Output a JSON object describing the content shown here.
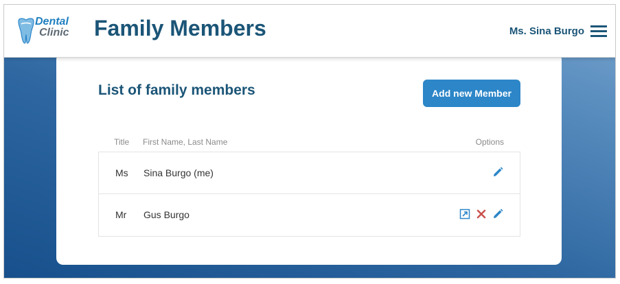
{
  "header": {
    "logo": {
      "line1": "Dental",
      "line2": "Clinic"
    },
    "title": "Family Members",
    "user_name": "Ms. Sina Burgo",
    "menu_icon": "hamburger-menu-icon"
  },
  "main": {
    "section_title": "List of family members",
    "add_button_label": "Add new Member",
    "table": {
      "columns": [
        "Title",
        "First Name, Last Name",
        "Options"
      ],
      "rows": [
        {
          "title": "Ms",
          "name": "Sina Burgo (me)",
          "options": [
            "edit-icon"
          ]
        },
        {
          "title": "Mr",
          "name": "Gus Burgo",
          "options": [
            "open-external-icon",
            "delete-icon",
            "edit-icon"
          ]
        }
      ]
    }
  },
  "colors": {
    "primary": "#1b5577",
    "button": "#2c86c8",
    "delete": "#c9534f",
    "edit": "#2c86c8"
  }
}
